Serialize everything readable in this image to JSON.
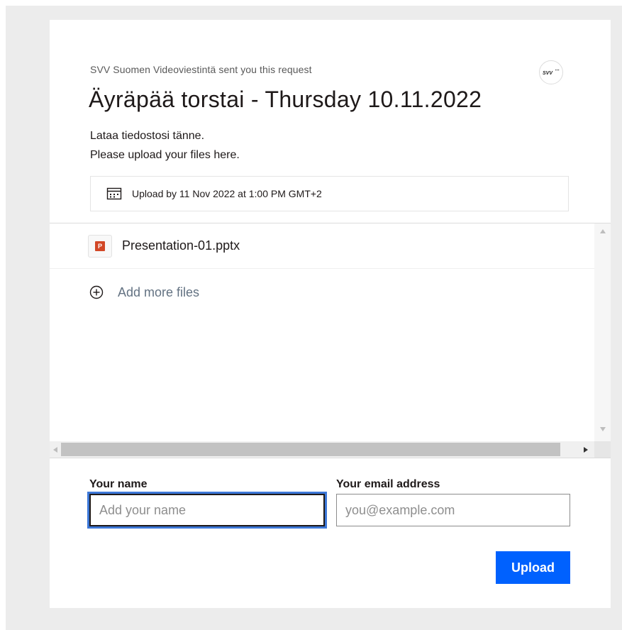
{
  "request": {
    "sender_line": "SVV Suomen Videoviestintä sent you this request",
    "logo_text": "SVV",
    "title": "Äyräpää torstai - Thursday 10.11.2022",
    "description_fi": "Lataa tiedostosi tänne.",
    "description_en": "Please upload your files here.",
    "deadline": "Upload by 11 Nov 2022 at 1:00 PM GMT+2"
  },
  "files": [
    {
      "name": "Presentation-01.pptx",
      "icon": "powerpoint-file-icon"
    }
  ],
  "add_more_label": "Add more files",
  "form": {
    "name_label": "Your name",
    "name_placeholder": "Add your name",
    "email_label": "Your email address",
    "email_placeholder": "you@example.com",
    "upload_label": "Upload"
  },
  "colors": {
    "accent": "#0061fe",
    "focus_ring": "#3d78d8",
    "powerpoint": "#d24726"
  }
}
